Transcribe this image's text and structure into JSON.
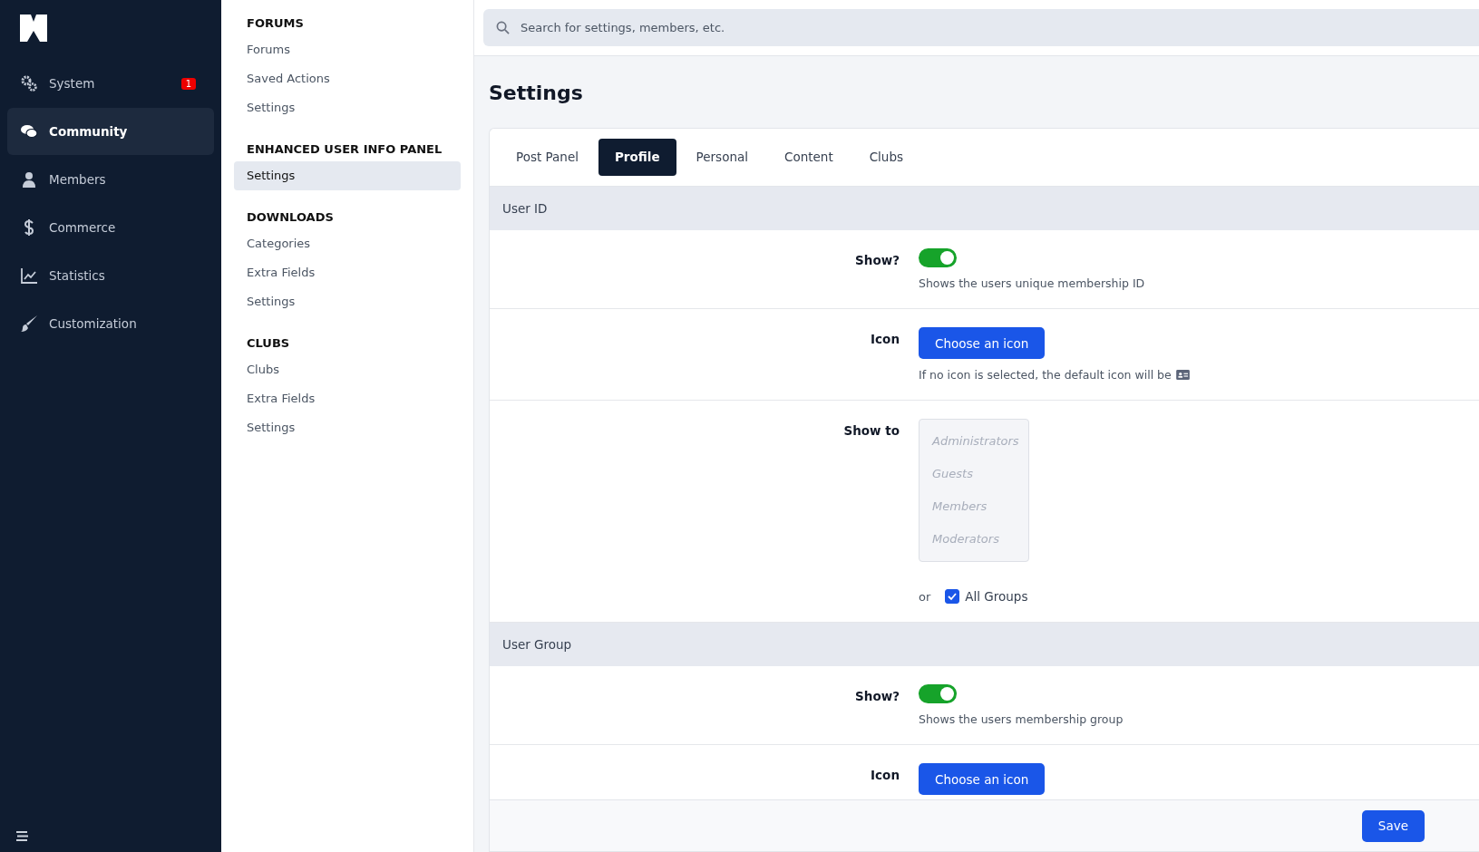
{
  "sidebar": {
    "items": [
      {
        "label": "System",
        "selected": false,
        "badge": "1"
      },
      {
        "label": "Community",
        "selected": true
      },
      {
        "label": "Members",
        "selected": false
      },
      {
        "label": "Commerce",
        "selected": false
      },
      {
        "label": "Statistics",
        "selected": false
      },
      {
        "label": "Customization",
        "selected": false
      }
    ]
  },
  "subnav": {
    "groups": [
      {
        "title": "FORUMS",
        "items": [
          {
            "label": "Forums",
            "selected": false
          },
          {
            "label": "Saved Actions",
            "selected": false
          },
          {
            "label": "Settings",
            "selected": false
          }
        ]
      },
      {
        "title": "ENHANCED USER INFO PANEL",
        "items": [
          {
            "label": "Settings",
            "selected": true
          }
        ]
      },
      {
        "title": "DOWNLOADS",
        "items": [
          {
            "label": "Categories",
            "selected": false
          },
          {
            "label": "Extra Fields",
            "selected": false
          },
          {
            "label": "Settings",
            "selected": false
          }
        ]
      },
      {
        "title": "CLUBS",
        "items": [
          {
            "label": "Clubs",
            "selected": false
          },
          {
            "label": "Extra Fields",
            "selected": false
          },
          {
            "label": "Settings",
            "selected": false
          }
        ]
      }
    ]
  },
  "search": {
    "placeholder": "Search for settings, members, etc."
  },
  "page_title": "Settings",
  "tabs": [
    {
      "label": "Post Panel",
      "selected": false
    },
    {
      "label": "Profile",
      "selected": true
    },
    {
      "label": "Personal",
      "selected": false
    },
    {
      "label": "Content",
      "selected": false
    },
    {
      "label": "Clubs",
      "selected": false
    }
  ],
  "sections": [
    {
      "title": "User ID",
      "rows": [
        {
          "kind": "toggle",
          "label": "Show?",
          "on": true,
          "hint": "Shows the users unique membership ID"
        },
        {
          "kind": "icon",
          "label": "Icon",
          "button": "Choose an icon",
          "hint": "If no icon is selected, the default icon will be"
        },
        {
          "kind": "groups",
          "label": "Show to",
          "options": [
            "Administrators",
            "Guests",
            "Members",
            "Moderators"
          ],
          "or": "or",
          "all_label": "All Groups",
          "all_checked": true
        }
      ]
    },
    {
      "title": "User Group",
      "rows": [
        {
          "kind": "toggle",
          "label": "Show?",
          "on": true,
          "hint": "Shows the users membership group"
        },
        {
          "kind": "icon",
          "label": "Icon",
          "button": "Choose an icon"
        }
      ]
    }
  ],
  "save_button": "Save"
}
